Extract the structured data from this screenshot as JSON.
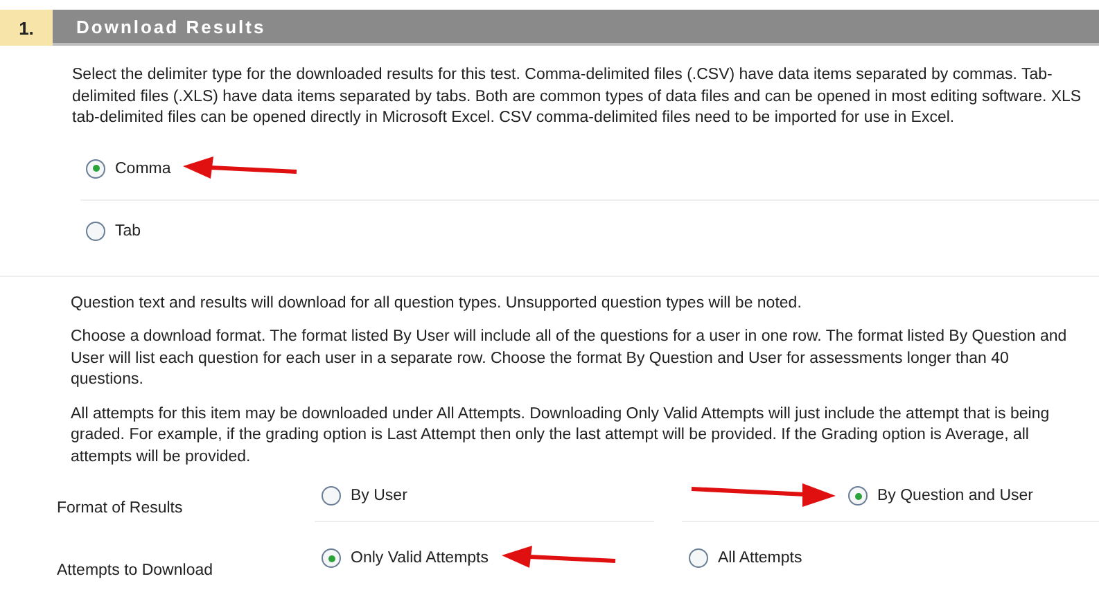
{
  "section": {
    "number": "1.",
    "title": "Download Results"
  },
  "intro": "Select the delimiter type for the downloaded results for this test. Comma-delimited files (.CSV) have data items separated by commas. Tab-delimited files (.XLS) have data items separated by tabs. Both are common types of data files and can be opened in most editing software. XLS tab-delimited files can be opened directly in Microsoft Excel. CSV comma-delimited files need to be imported for use in Excel.",
  "delimiters": [
    {
      "label": "Comma",
      "selected": true,
      "arrow_after": true
    },
    {
      "label": "Tab",
      "selected": false
    }
  ],
  "notes": [
    "Question text and results will download for all question types. Unsupported question types will be noted.",
    "Choose a download format. The format listed By User will include all of the questions for a user in one row. The format listed By Question and User will list each question for each user in a separate row. Choose the format By Question and User for assessments longer than 40 questions.",
    "All attempts for this item may be downloaded under All Attempts. Downloading Only Valid Attempts will just include the attempt that is being graded. For example, if the grading option is Last Attempt then only the last attempt will be provided. If the Grading option is Average, all attempts will be provided."
  ],
  "settings": [
    {
      "label": "Format of Results",
      "options": [
        {
          "label": "By User",
          "selected": false
        },
        {
          "label": "By Question and User",
          "selected": true,
          "arrow_before": true
        }
      ]
    },
    {
      "label": "Attempts to Download",
      "options": [
        {
          "label": "Only Valid Attempts",
          "selected": true,
          "arrow_after": true
        },
        {
          "label": "All Attempts",
          "selected": false
        }
      ]
    }
  ]
}
